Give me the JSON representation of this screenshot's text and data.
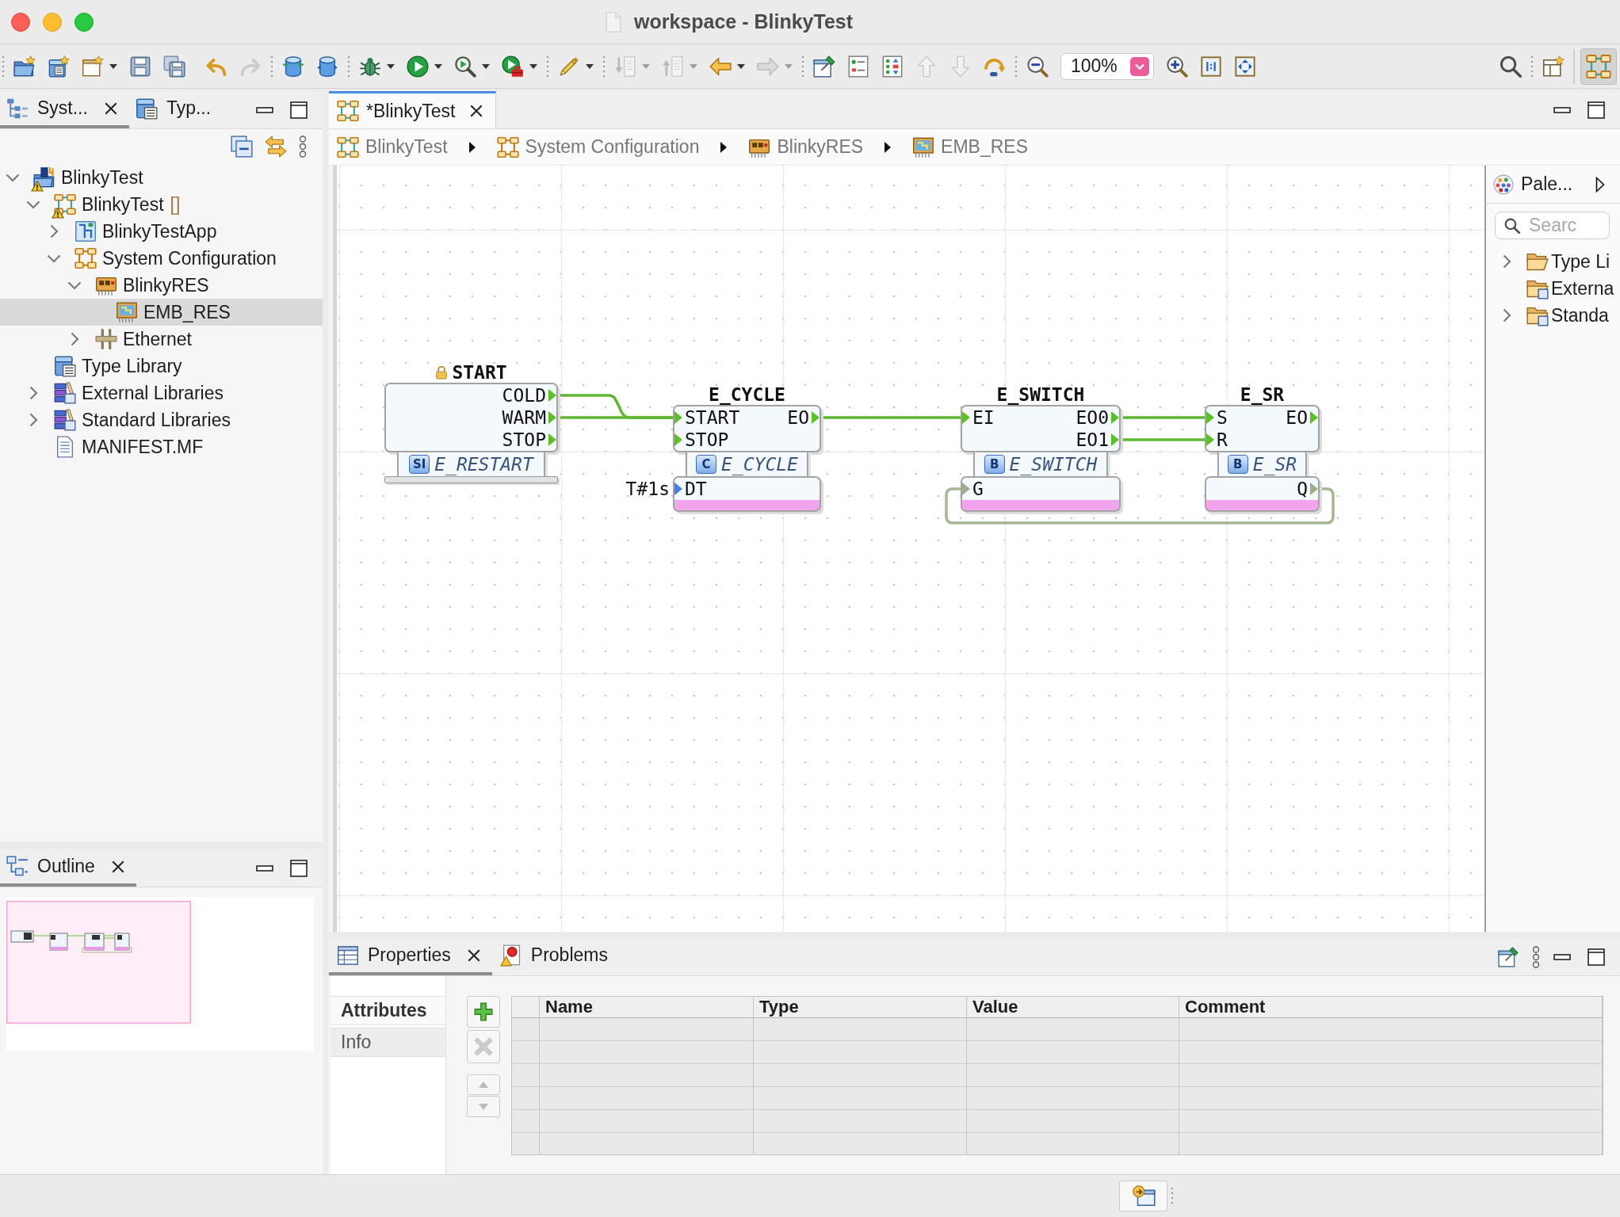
{
  "window": {
    "title": "workspace - BlinkyTest"
  },
  "toolbar": {
    "buttons": [
      {
        "disabled": false,
        "dropdown": false
      },
      {
        "disabled": false,
        "dropdown": false
      },
      {
        "disabled": false,
        "dropdown": true
      },
      {
        "disabled": false,
        "dropdown": false
      },
      {
        "disabled": false,
        "dropdown": false
      },
      {
        "disabled": false,
        "dropdown": false
      },
      {
        "disabled": true,
        "dropdown": false
      },
      {
        "disabled": false,
        "dropdown": false
      },
      {
        "disabled": false,
        "dropdown": false
      },
      {
        "disabled": false,
        "dropdown": true
      },
      {
        "disabled": false,
        "dropdown": true
      },
      {
        "disabled": false,
        "dropdown": true
      },
      {
        "disabled": false,
        "dropdown": true
      },
      {
        "disabled": false,
        "dropdown": true
      },
      {
        "disabled": true,
        "dropdown": true
      },
      {
        "disabled": true,
        "dropdown": true
      },
      {
        "disabled": false,
        "dropdown": true
      },
      {
        "disabled": true,
        "dropdown": true
      },
      {
        "disabled": false,
        "dropdown": false
      },
      {
        "disabled": false,
        "dropdown": false
      },
      {
        "disabled": false,
        "dropdown": false
      },
      {
        "disabled": true,
        "dropdown": false
      },
      {
        "disabled": true,
        "dropdown": false
      },
      {
        "disabled": false,
        "dropdown": false
      },
      {
        "disabled": false,
        "dropdown": false
      },
      {
        "disabled": false,
        "dropdown": false
      },
      {
        "disabled": false,
        "dropdown": false
      },
      {
        "disabled": false,
        "dropdown": false
      },
      {
        "disabled": false,
        "dropdown": false
      },
      {
        "disabled": false,
        "dropdown": false
      }
    ],
    "zoom": "100%",
    "perspectives": [
      {
        "selected": true
      }
    ]
  },
  "explorer": {
    "tabs": [
      {
        "label": "Syst...",
        "selected": true
      },
      {
        "label": "Typ...",
        "selected": false
      }
    ],
    "tree": [
      {
        "label": "BlinkyTest",
        "kind": "project",
        "warning": true,
        "expanded": true,
        "selected": false,
        "children": [
          {
            "label": "BlinkyTest",
            "decoration": "[]",
            "kind": "system",
            "warning": true,
            "expanded": true,
            "selected": false,
            "children": [
              {
                "label": "BlinkyTestApp",
                "kind": "application",
                "warning": false,
                "expanded": false,
                "selected": false
              },
              {
                "label": "System Configuration",
                "kind": "system-configuration",
                "warning": false,
                "expanded": true,
                "selected": false,
                "children": [
                  {
                    "label": "BlinkyRES",
                    "kind": "device",
                    "warning": false,
                    "expanded": true,
                    "selected": false,
                    "children": [
                      {
                        "label": "EMB_RES",
                        "kind": "resource",
                        "warning": false,
                        "selected": true
                      }
                    ]
                  },
                  {
                    "label": "Ethernet",
                    "kind": "segment",
                    "warning": false,
                    "expanded": false,
                    "selected": false
                  }
                ]
              }
            ]
          },
          {
            "label": "Type Library",
            "kind": "type-library",
            "warning": false,
            "selected": false
          },
          {
            "label": "External Libraries",
            "kind": "library",
            "warning": false,
            "expanded": false,
            "selected": false
          },
          {
            "label": "Standard Libraries",
            "kind": "library",
            "warning": false,
            "expanded": false,
            "selected": false
          },
          {
            "label": "MANIFEST.MF",
            "kind": "file",
            "warning": false,
            "selected": false
          }
        ]
      }
    ]
  },
  "outline": {
    "tabs": [
      {
        "label": "Outline",
        "selected": true
      }
    ]
  },
  "editor": {
    "tabs": [
      {
        "label": "*BlinkyTest",
        "selected": true
      }
    ],
    "breadcrumb": [
      {
        "label": "BlinkyTest",
        "kind": "system"
      },
      {
        "label": "System Configuration",
        "kind": "system-configuration"
      },
      {
        "label": "BlinkyRES",
        "kind": "device"
      },
      {
        "label": "EMB_RES",
        "kind": "resource"
      }
    ],
    "diagram": {
      "blocks": [
        {
          "instance": "START",
          "locked": true,
          "type": "E_RESTART",
          "badge": "SI",
          "event_outputs": [
            {
              "name": "COLD"
            },
            {
              "name": "WARM"
            },
            {
              "name": "STOP"
            }
          ]
        },
        {
          "instance": "E_CYCLE",
          "locked": false,
          "type": "E_CYCLE",
          "badge": "C",
          "event_inputs": [
            {
              "name": "START"
            },
            {
              "name": "STOP"
            }
          ],
          "event_outputs": [
            {
              "name": "EO"
            }
          ],
          "data_inputs": [
            {
              "name": "DT",
              "color": "#3f80e4",
              "value": "T#1s"
            }
          ]
        },
        {
          "instance": "E_SWITCH",
          "locked": false,
          "type": "E_SWITCH",
          "badge": "B",
          "event_inputs": [
            {
              "name": "EI"
            }
          ],
          "event_outputs": [
            {
              "name": "EO0"
            },
            {
              "name": "EO1"
            }
          ],
          "data_inputs": [
            {
              "name": "G",
              "color": "#9cae88"
            }
          ]
        },
        {
          "instance": "E_SR",
          "locked": false,
          "type": "E_SR",
          "badge": "B",
          "event_inputs": [
            {
              "name": "S"
            },
            {
              "name": "R"
            }
          ],
          "event_outputs": [
            {
              "name": "EO"
            }
          ],
          "data_outputs": [
            {
              "name": "Q",
              "color": "#9cae88"
            }
          ]
        }
      ],
      "connections": [
        {
          "kind": "event"
        },
        {
          "kind": "event"
        },
        {
          "kind": "event"
        },
        {
          "kind": "event"
        },
        {
          "kind": "event"
        },
        {
          "kind": "data"
        }
      ]
    },
    "palette": {
      "title": "Pale...",
      "search": {
        "placeholder": "Searc"
      },
      "items": [
        {
          "label": "Type Li",
          "kind": "folder",
          "expanded": false
        },
        {
          "label": "Externa",
          "kind": "library-folder"
        },
        {
          "label": "Standa",
          "kind": "library-folder",
          "expanded": false
        }
      ]
    }
  },
  "properties": {
    "tabs": [
      {
        "label": "Properties",
        "selected": true
      },
      {
        "label": "Problems",
        "selected": false
      }
    ],
    "sections": [
      {
        "label": "Attributes",
        "selected": true
      },
      {
        "label": "Info",
        "selected": false
      }
    ],
    "actions": [
      {
        "kind": "add",
        "disabled": false
      },
      {
        "kind": "delete",
        "disabled": true
      },
      {
        "kind": "up",
        "disabled": true
      },
      {
        "kind": "down",
        "disabled": true
      }
    ],
    "table": {
      "columns": [
        "Name",
        "Type",
        "Value",
        "Comment"
      ]
    }
  }
}
